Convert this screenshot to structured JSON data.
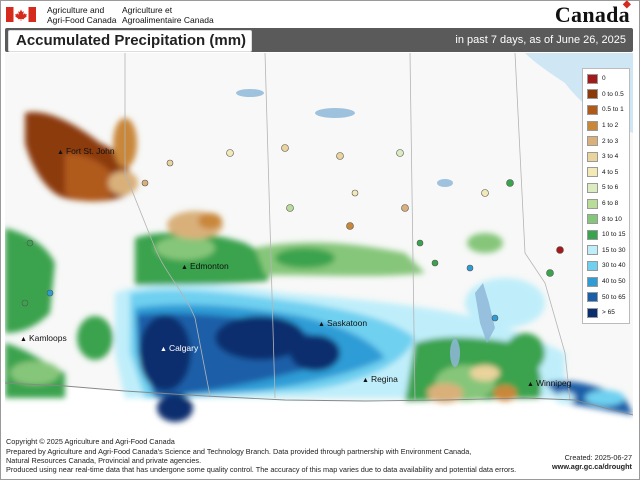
{
  "header": {
    "agency_en_1": "Agriculture and",
    "agency_en_2": "Agri-Food Canada",
    "agency_fr_1": "Agriculture et",
    "agency_fr_2": "Agroalimentaire Canada",
    "wordmark": "Canada"
  },
  "title": "Accumulated Precipitation (mm)",
  "subtitle": "in past 7 days, as of June 26, 2025",
  "legend": [
    {
      "label": "0",
      "color": "#a31a1a"
    },
    {
      "label": "0 to 0.5",
      "color": "#8c3a0c"
    },
    {
      "label": "0.5 to 1",
      "color": "#b05a1a"
    },
    {
      "label": "1 to 2",
      "color": "#c9873a"
    },
    {
      "label": "2 to 3",
      "color": "#d9b07a"
    },
    {
      "label": "3 to 4",
      "color": "#ead39c"
    },
    {
      "label": "4 to 5",
      "color": "#f2e8b8"
    },
    {
      "label": "5 to 6",
      "color": "#dcecc0"
    },
    {
      "label": "6 to 8",
      "color": "#b9dc98"
    },
    {
      "label": "8 to 10",
      "color": "#86c67a"
    },
    {
      "label": "10 to 15",
      "color": "#3aa34e"
    },
    {
      "label": "15 to 30",
      "color": "#bfeefa"
    },
    {
      "label": "30 to 40",
      "color": "#6fd0f0"
    },
    {
      "label": "40 to 50",
      "color": "#2f9cd6"
    },
    {
      "label": "50 to 65",
      "color": "#1a5ea8"
    },
    {
      "label": "> 65",
      "color": "#0b2e6e"
    }
  ],
  "cities": [
    {
      "name": "Fort St. John"
    },
    {
      "name": "Edmonton"
    },
    {
      "name": "Kamloops"
    },
    {
      "name": "Calgary"
    },
    {
      "name": "Saskatoon"
    },
    {
      "name": "Regina"
    },
    {
      "name": "Winnipeg"
    }
  ],
  "footer": {
    "copyright": "Copyright © 2025 Agriculture and Agri-Food Canada",
    "line1": "Prepared by Agriculture and Agri-Food Canada's Science and Technology Branch. Data provided through partnership with Environment Canada,",
    "line2": "Natural Resources Canada, Provincial and private agencies.",
    "line3": "Produced using near real-time data that has undergone some quality control. The accuracy of this map varies due to data availability and potential data errors.",
    "created": "Created:  2025-06-27",
    "url": "www.agr.gc.ca/drought"
  }
}
